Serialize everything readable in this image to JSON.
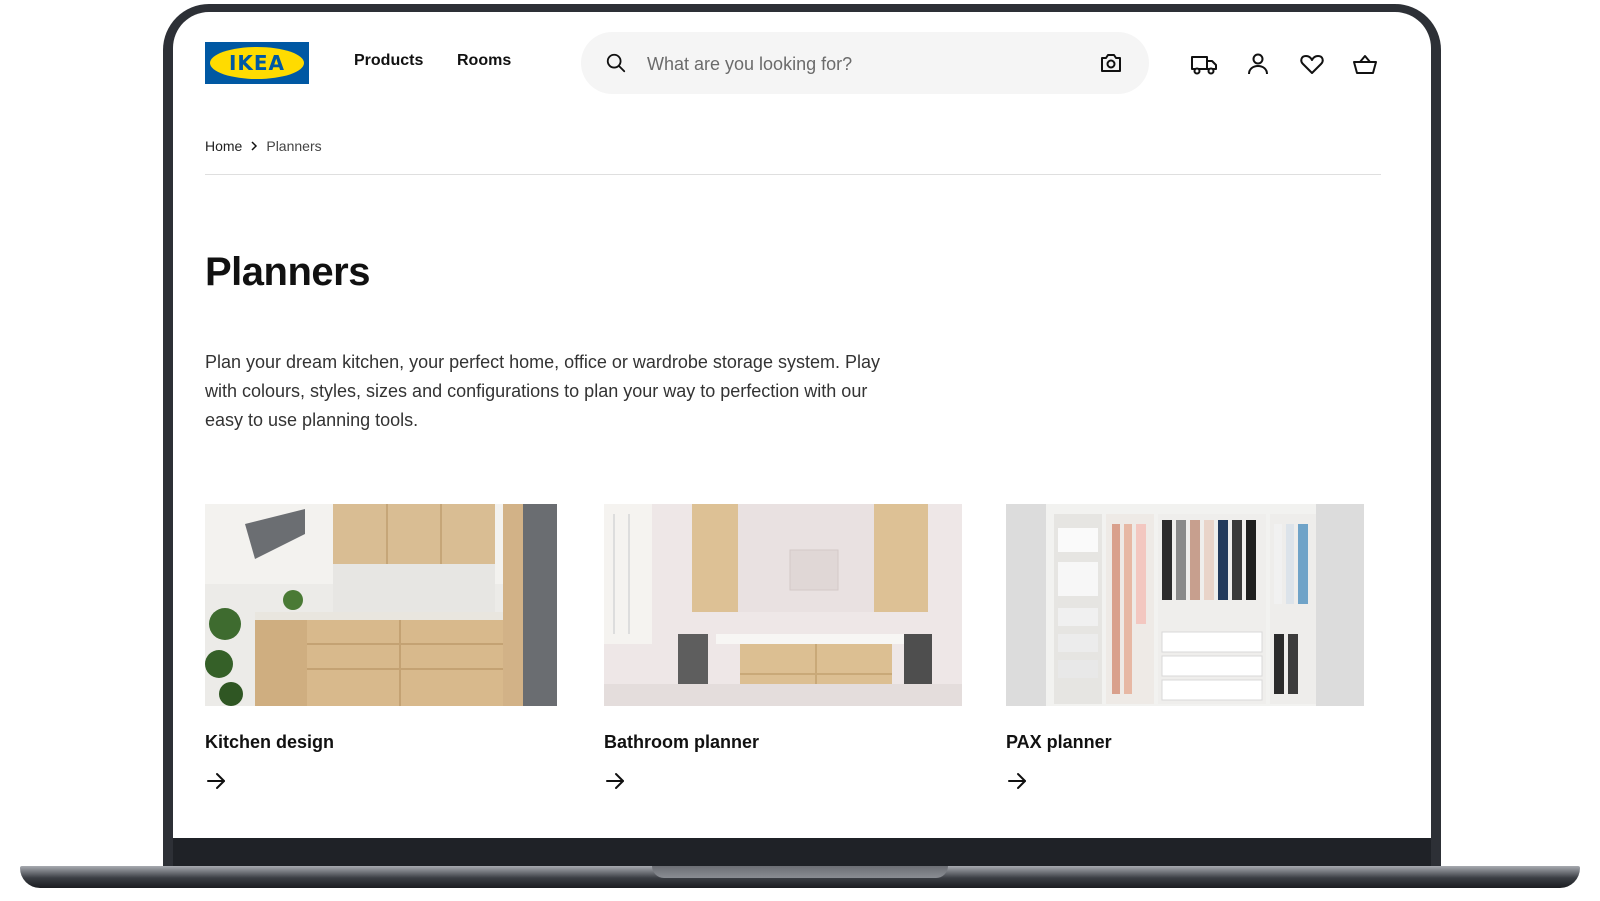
{
  "header": {
    "logo_text": "IKEA",
    "nav": [
      {
        "label": "Products"
      },
      {
        "label": "Rooms"
      }
    ],
    "search": {
      "placeholder": "What are you looking for?"
    },
    "icons": [
      "delivery-truck-icon",
      "user-icon",
      "heart-icon",
      "basket-icon"
    ]
  },
  "breadcrumb": {
    "home": "Home",
    "current": "Planners"
  },
  "page": {
    "title": "Planners",
    "description": "Plan your dream kitchen, your perfect home, office or wardrobe storage system. Play with colours, styles, sizes and configurations to plan your way to perfection with our easy to use planning tools."
  },
  "cards": [
    {
      "title": "Kitchen design"
    },
    {
      "title": "Bathroom planner"
    },
    {
      "title": "PAX planner"
    }
  ],
  "colors": {
    "ikea_blue": "#0058a3",
    "ikea_yellow": "#ffdb00",
    "frame": "#2d3036"
  }
}
